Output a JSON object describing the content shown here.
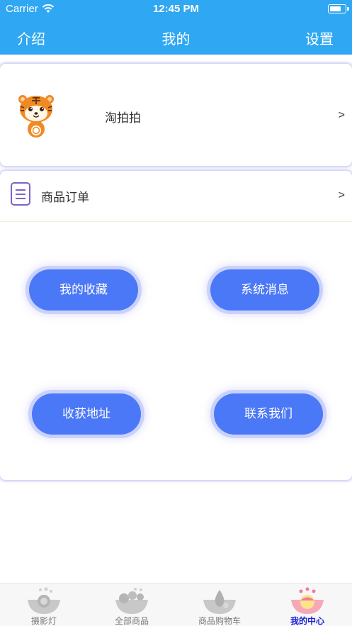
{
  "status_bar": {
    "carrier": "Carrier",
    "time": "12:45 PM"
  },
  "nav": {
    "left": "介绍",
    "title": "我的",
    "right": "设置"
  },
  "profile": {
    "name": "淘拍拍",
    "chevron": ">",
    "avatar": "tiger-mascot-icon"
  },
  "orders": {
    "label": "商品订单",
    "chevron": ">",
    "icon": "document-icon"
  },
  "buttons": {
    "favorites": "我的收藏",
    "messages": "系统消息",
    "address": "收获地址",
    "contact": "联系我们"
  },
  "tabs": [
    {
      "label": "摄影灯",
      "active": false
    },
    {
      "label": "全部商品",
      "active": false
    },
    {
      "label": "商品购物车",
      "active": false
    },
    {
      "label": "我的中心",
      "active": true
    }
  ],
  "colors": {
    "nav_blue": "#2fa7f2",
    "button_blue": "#4b78f6",
    "active_tab": "#1a22d6",
    "icon_purple": "#7e62c9"
  }
}
